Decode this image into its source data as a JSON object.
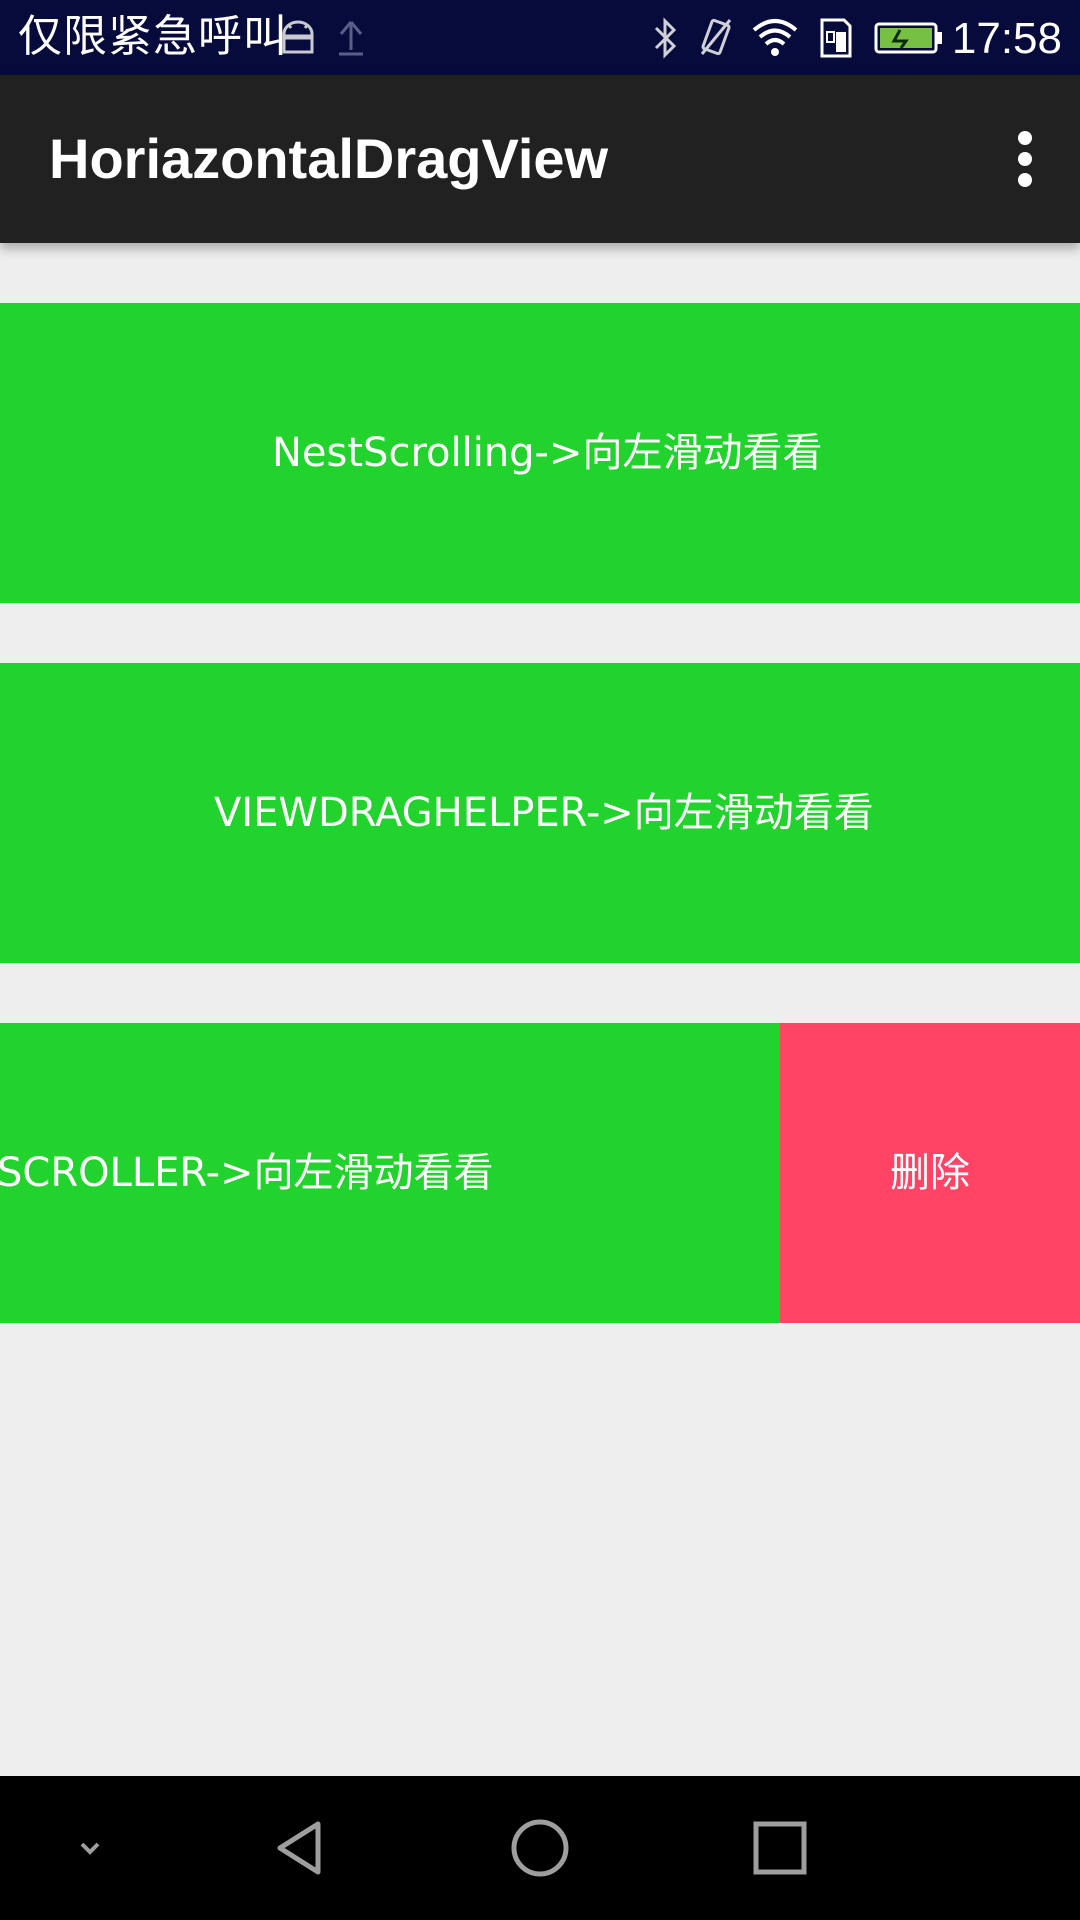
{
  "status_bar": {
    "carrier_text": "仅限紧急呼叫",
    "time": "17:58",
    "icons": [
      "android-icon",
      "upload-icon",
      "bluetooth-icon",
      "vibrate-icon",
      "wifi-icon",
      "sim-icon",
      "battery-charging-icon"
    ],
    "background": "#060B3B"
  },
  "app_bar": {
    "title": "HoriazontalDragView",
    "background": "#212121",
    "overflow_icon": "more-vert-icon"
  },
  "rows": [
    {
      "label": "NestScrolling->向左滑动看看"
    },
    {
      "label": "VIEWDRAGHELPER->向左滑动看看"
    },
    {
      "label": "SCROLLER->向左滑动看看",
      "action_label": "删除"
    }
  ],
  "colors": {
    "row_green": "#22D22D",
    "delete_red": "#FF4466",
    "page_background": "#EEEEEE"
  },
  "nav_bar": {
    "icons": [
      "chevron-down-icon",
      "back-icon",
      "home-icon",
      "recents-icon"
    ],
    "background": "#000000"
  }
}
